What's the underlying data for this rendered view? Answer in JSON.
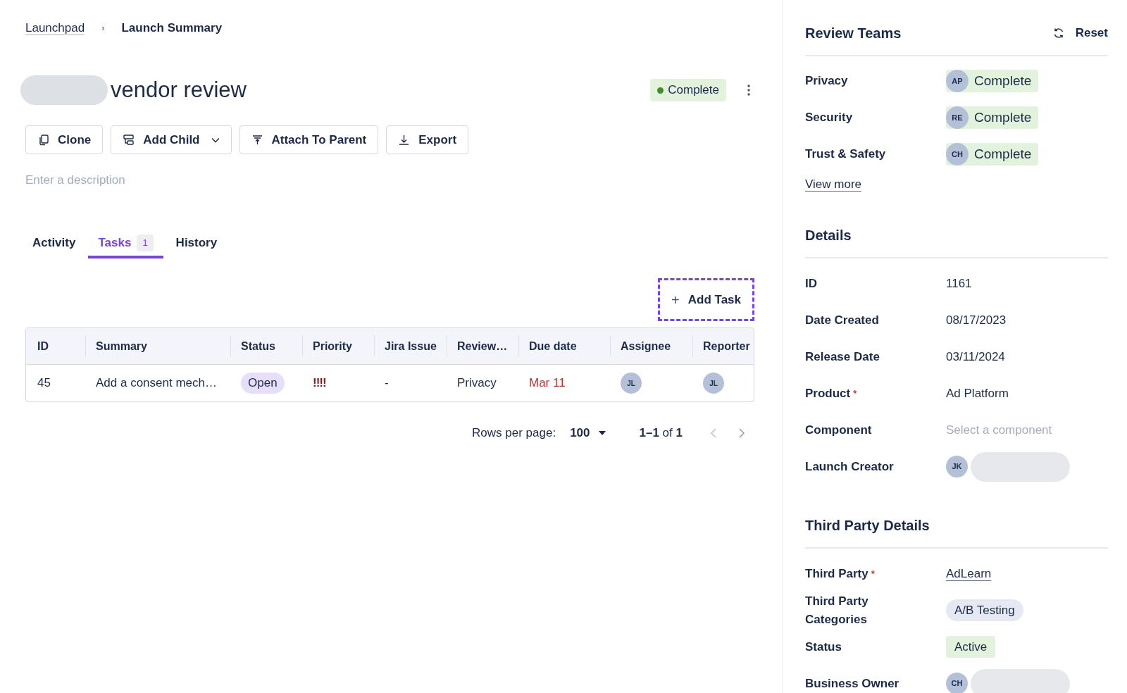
{
  "breadcrumb": {
    "items": [
      {
        "label": "Launchpad",
        "kind": "link"
      },
      {
        "label": "Launch Summary",
        "kind": "current"
      }
    ],
    "separator": "›"
  },
  "title": {
    "text": "vendor review"
  },
  "status_badge": {
    "label": "Complete",
    "color": "#3f8f29"
  },
  "actions": [
    {
      "label": "Clone",
      "dropdown": false
    },
    {
      "label": "Add Child",
      "dropdown": true
    },
    {
      "label": "Attach To Parent",
      "dropdown": false
    },
    {
      "label": "Export",
      "dropdown": false
    }
  ],
  "description": {
    "placeholder": "Enter a description"
  },
  "tabs": [
    {
      "label": "Activity",
      "selected": false
    },
    {
      "label": "Tasks",
      "count": "1",
      "selected": true
    },
    {
      "label": "History",
      "selected": false
    }
  ],
  "add_task_button": {
    "label": "Add Task",
    "icon": "+"
  },
  "table": {
    "columns": [
      {
        "label": "ID",
        "kind": "text"
      },
      {
        "label": "Summary",
        "kind": "text"
      },
      {
        "label": "Status",
        "kind": "pill"
      },
      {
        "label": "Priority",
        "kind": "priority"
      },
      {
        "label": "Jira Issue",
        "kind": "text"
      },
      {
        "label": "Review…",
        "kind": "text"
      },
      {
        "label": "Due date",
        "kind": "date"
      },
      {
        "label": "Assignee",
        "kind": "avatar"
      },
      {
        "label": "Reporter",
        "kind": "avatar"
      }
    ],
    "rows": [
      {
        "cells": [
          "45",
          "Add a consent mech…",
          "Open",
          "!!!!",
          "-",
          "Privacy",
          "Mar 11",
          "JL",
          "JL"
        ],
        "overdue": true
      }
    ]
  },
  "pagination": {
    "rows_per_page_label": "Rows per page:",
    "rows_per_page": "100",
    "range": "1–1",
    "of": "of",
    "total": "1"
  },
  "review_teams": {
    "title": "Review Teams",
    "reset_label": "Reset",
    "teams": [
      {
        "name": "Privacy",
        "initials": "AP",
        "status": "Complete"
      },
      {
        "name": "Security",
        "initials": "RE",
        "status": "Complete"
      },
      {
        "name": "Trust & Safety",
        "initials": "CH",
        "status": "Complete"
      }
    ],
    "view_more": "View more"
  },
  "details": {
    "title": "Details",
    "fields": [
      {
        "label": "ID",
        "kind": "text",
        "value": "1161"
      },
      {
        "label": "Date Created",
        "kind": "text",
        "value": "08/17/2023"
      },
      {
        "label": "Release Date",
        "kind": "text",
        "value": "03/11/2024"
      },
      {
        "label": "Product",
        "kind": "text",
        "value": "Ad Platform",
        "required_mark": "*"
      },
      {
        "label": "Component",
        "kind": "placeholder",
        "placeholder": "Select a component"
      },
      {
        "label": "Launch Creator",
        "kind": "person",
        "value": "JK"
      }
    ]
  },
  "third_party_details": {
    "title": "Third Party Details",
    "fields": [
      {
        "label": "Third Party",
        "kind": "link",
        "value": "AdLearn",
        "required_mark": "*"
      },
      {
        "label": "Third Party Categories",
        "kind": "tag",
        "value": "A/B Testing"
      },
      {
        "label": "Status",
        "kind": "status",
        "value": "Active"
      },
      {
        "label": "Business Owner",
        "kind": "person",
        "value": "CH"
      }
    ]
  }
}
